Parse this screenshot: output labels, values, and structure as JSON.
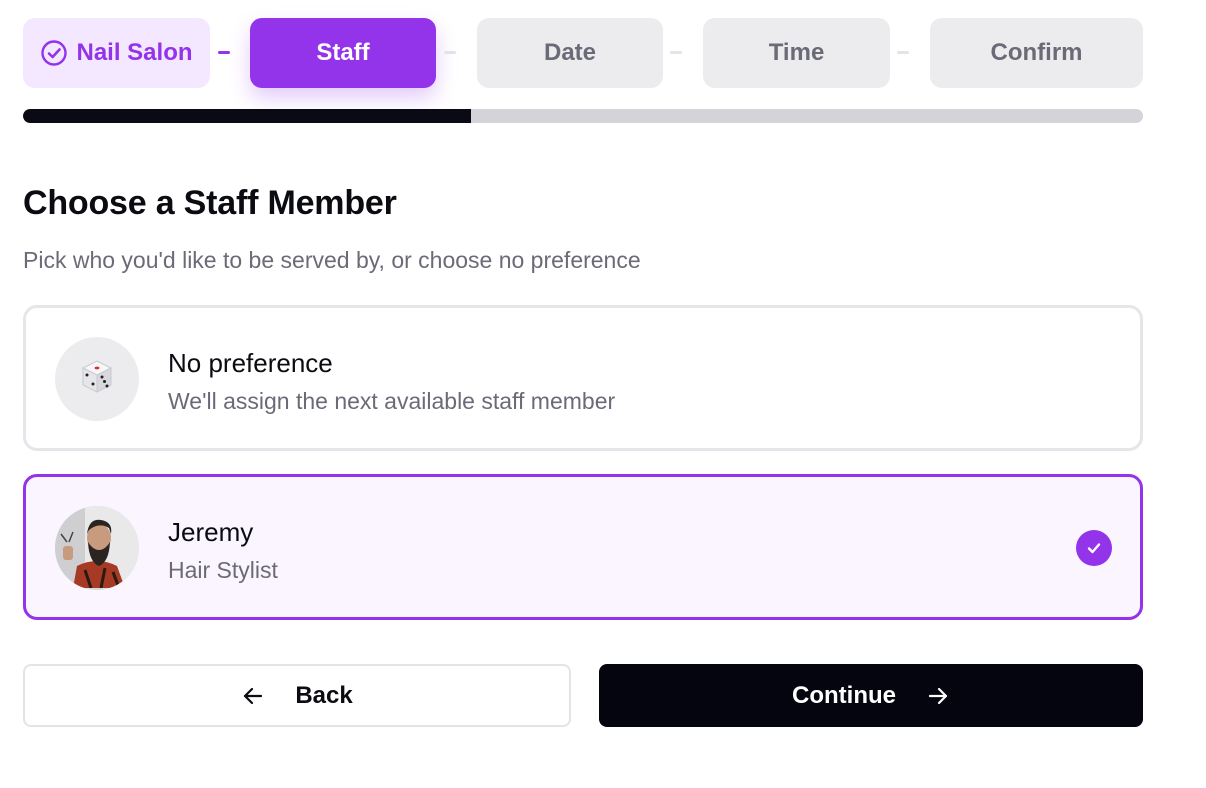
{
  "stepper": {
    "steps": [
      {
        "label": "Nail Salon",
        "state": "completed"
      },
      {
        "label": "Staff",
        "state": "active"
      },
      {
        "label": "Date",
        "state": "pending"
      },
      {
        "label": "Time",
        "state": "pending"
      },
      {
        "label": "Confirm",
        "state": "pending"
      }
    ],
    "progress_fraction": 0.4
  },
  "main": {
    "title": "Choose a Staff Member",
    "subtitle": "Pick who you'd like to be served by, or choose no preference"
  },
  "options": [
    {
      "name": "No preference",
      "description": "We'll assign the next available staff member",
      "icon": "dice-icon",
      "selected": false
    },
    {
      "name": "Jeremy",
      "description": "Hair Stylist",
      "icon": "staff-photo",
      "selected": true
    }
  ],
  "actions": {
    "back_label": "Back",
    "continue_label": "Continue"
  },
  "colors": {
    "accent": "#9333ea",
    "accent_light": "#f3e8ff",
    "dark": "#05050f",
    "muted_text": "#6b6b78"
  }
}
